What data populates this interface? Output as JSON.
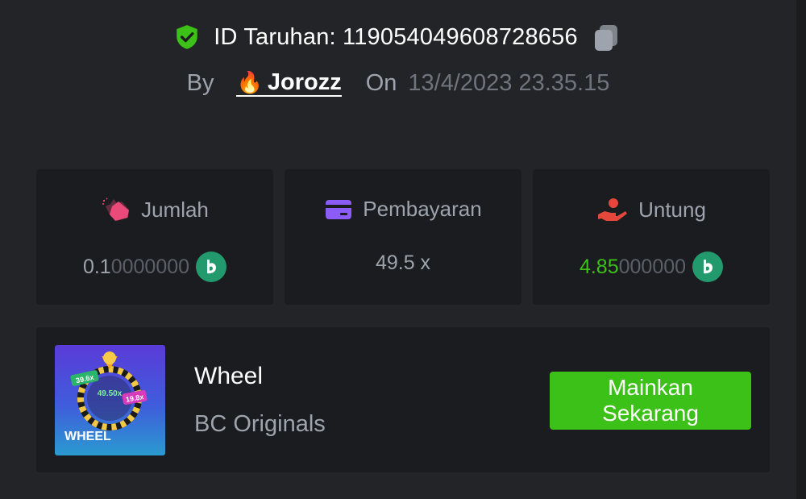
{
  "header": {
    "bet_id": "ID Taruhan: 119054049608728656",
    "by_label": "By",
    "username": "Jorozz",
    "on_label": "On",
    "date": "13/4/2023 23.35.15"
  },
  "stats": [
    {
      "label": "Jumlah",
      "value_main": "0.1",
      "value_dim": "0000000",
      "icon": "bet-amount-icon"
    },
    {
      "label": "Pembayaran",
      "value_main": "49.5 x",
      "value_dim": "",
      "icon": "card-icon"
    },
    {
      "label": "Untung",
      "value_main": "4.85",
      "value_dim": "000000",
      "icon": "profit-hand-icon"
    }
  ],
  "game": {
    "name": "Wheel",
    "provider": "BC Originals",
    "play_label": "Mainkan Sekarang",
    "thumb_title": "WHEEL",
    "thumb_mult_1": "39.6x",
    "thumb_mult_2": "49.50x",
    "thumb_mult_3": "19.8x"
  },
  "colors": {
    "accent_green": "#3bc117",
    "coin": "#229a6e",
    "background": "#232427",
    "card": "#1b1c1f"
  }
}
